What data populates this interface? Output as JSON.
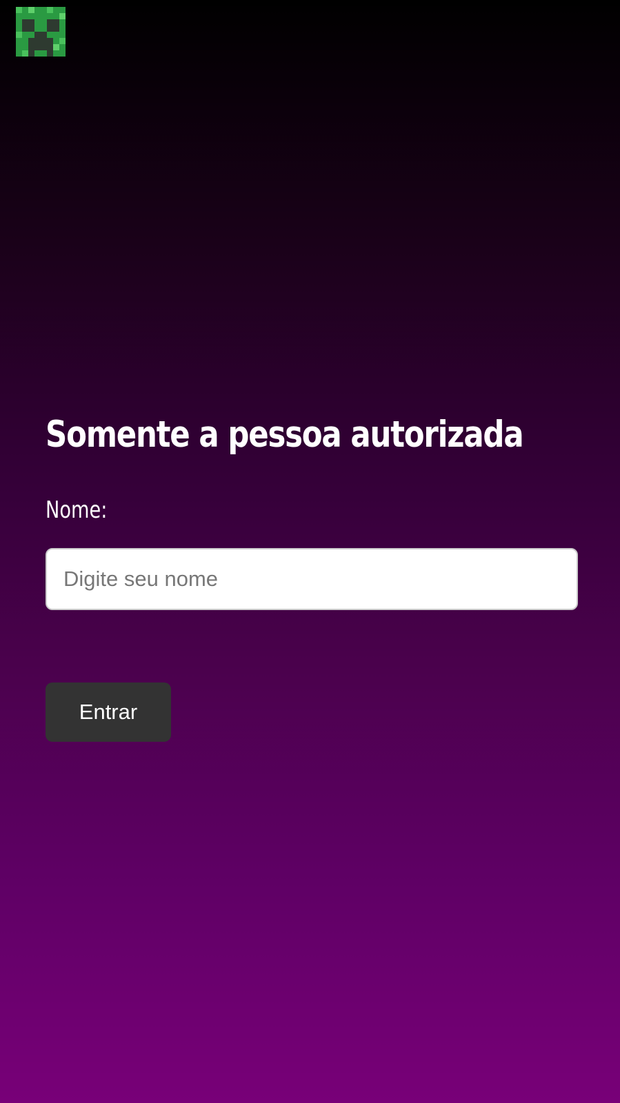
{
  "logo": {
    "icon": "creeper-face-icon",
    "colors": {
      "base": "#2a9a42",
      "light": "#49c15c",
      "face": "#2e3a30"
    }
  },
  "form": {
    "title": "Somente a pessoa autorizada",
    "name_label": "Nome:",
    "name_input": {
      "value": "",
      "placeholder": "Digite seu nome"
    },
    "submit_label": "Entrar"
  },
  "theme": {
    "gradient_top": "#000000",
    "gradient_bottom": "#780078",
    "button_bg": "#333333"
  }
}
